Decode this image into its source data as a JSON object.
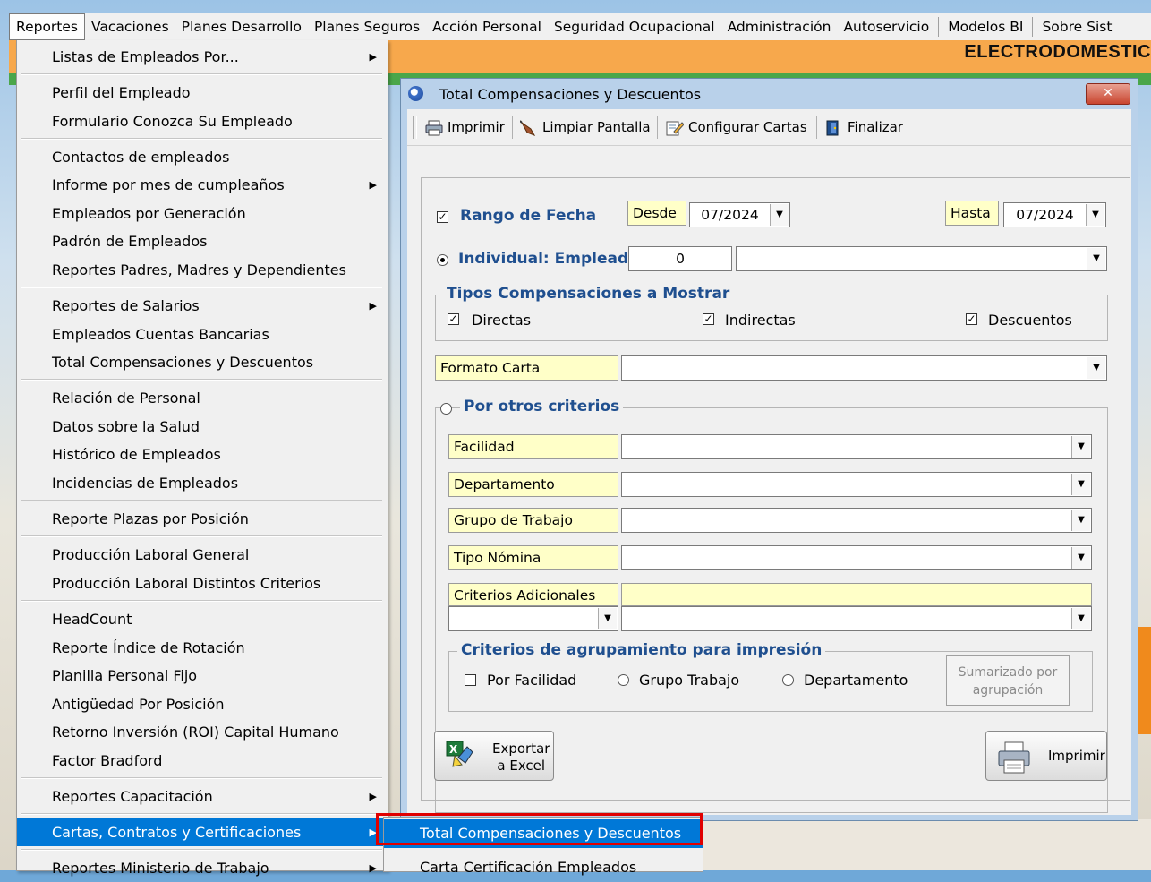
{
  "menubar": {
    "items": [
      "Reportes",
      "Vacaciones",
      "Planes Desarrollo",
      "Planes Seguros",
      "Acción Personal",
      "Seguridad Ocupacional",
      "Administración",
      "Autoservicio",
      "Modelos BI",
      "Sobre Sist"
    ]
  },
  "company_name": "ELECTRODOMESTIC",
  "reportes_menu": {
    "items": [
      "Listas de Empleados Por...",
      "Perfil del Empleado",
      "Formulario Conozca Su Empleado",
      "Contactos de empleados",
      "Informe por mes de cumpleaños",
      "Empleados por Generación",
      "Padrón de Empleados",
      "Reportes Padres, Madres y Dependientes",
      "Reportes de Salarios",
      "Empleados Cuentas Bancarias",
      "Total Compensaciones y Descuentos",
      "Relación de Personal",
      "Datos sobre la Salud",
      "Histórico de Empleados",
      "Incidencias de Empleados",
      "Reporte Plazas por Posición",
      "Producción Laboral General",
      "Producción Laboral Distintos Criterios",
      "HeadCount",
      "Reporte Índice de Rotación",
      "Planilla Personal Fijo",
      "Antigüedad Por Posición",
      "Retorno Inversión (ROI) Capital Humano",
      "Factor Bradford",
      "Reportes Capacitación",
      "Cartas, Contratos y Certificaciones",
      "Reportes Ministerio de Trabajo"
    ],
    "highlighted": "Cartas, Contratos y Certificaciones"
  },
  "submenu": {
    "items": [
      "Total Compensaciones y Descuentos",
      "Carta Certificación Empleados"
    ]
  },
  "dialog": {
    "title": "Total Compensaciones y Descuentos",
    "close_label": "✕",
    "toolbar": {
      "print": "Imprimir",
      "clear": "Limpiar Pantalla",
      "configure": "Configurar Cartas",
      "finish": "Finalizar"
    },
    "date_range": {
      "label": "Rango de Fecha",
      "checked": true,
      "from_label": "Desde",
      "from_value": "07/2024",
      "to_label": "Hasta",
      "to_value": "07/2024"
    },
    "individual": {
      "label": "Individual: Empleado",
      "selected": true,
      "employee_id": "0",
      "employee_name": ""
    },
    "types_group": {
      "title": "Tipos Compensaciones a Mostrar",
      "directas": "Directas",
      "indirectas": "Indirectas",
      "descuentos": "Descuentos"
    },
    "formato_carta": {
      "label": "Formato Carta",
      "value": ""
    },
    "other_criteria": {
      "title": "Por otros criterios",
      "facilidad": "Facilidad",
      "departamento": "Departamento",
      "grupo_trabajo": "Grupo de Trabajo",
      "tipo_nomina": "Tipo Nómina",
      "criterios_adicionales": "Criterios Adicionales"
    },
    "grouping": {
      "title": "Criterios de agrupamiento para impresión",
      "por_facilidad": "Por Facilidad",
      "grupo_trabajo": "Grupo Trabajo",
      "departamento": "Departamento",
      "sumarizado_line1": "Sumarizado por",
      "sumarizado_line2": "agrupación"
    },
    "export_line1": "Exportar",
    "export_line2": "a Excel",
    "print_button": "Imprimir"
  },
  "colors": {
    "menu_highlight": "#0078d7",
    "label_yellow": "#ffffc8",
    "header_orange": "#f7a84c",
    "title_blue": "#1f4f8f",
    "red_outline": "#e00000"
  }
}
